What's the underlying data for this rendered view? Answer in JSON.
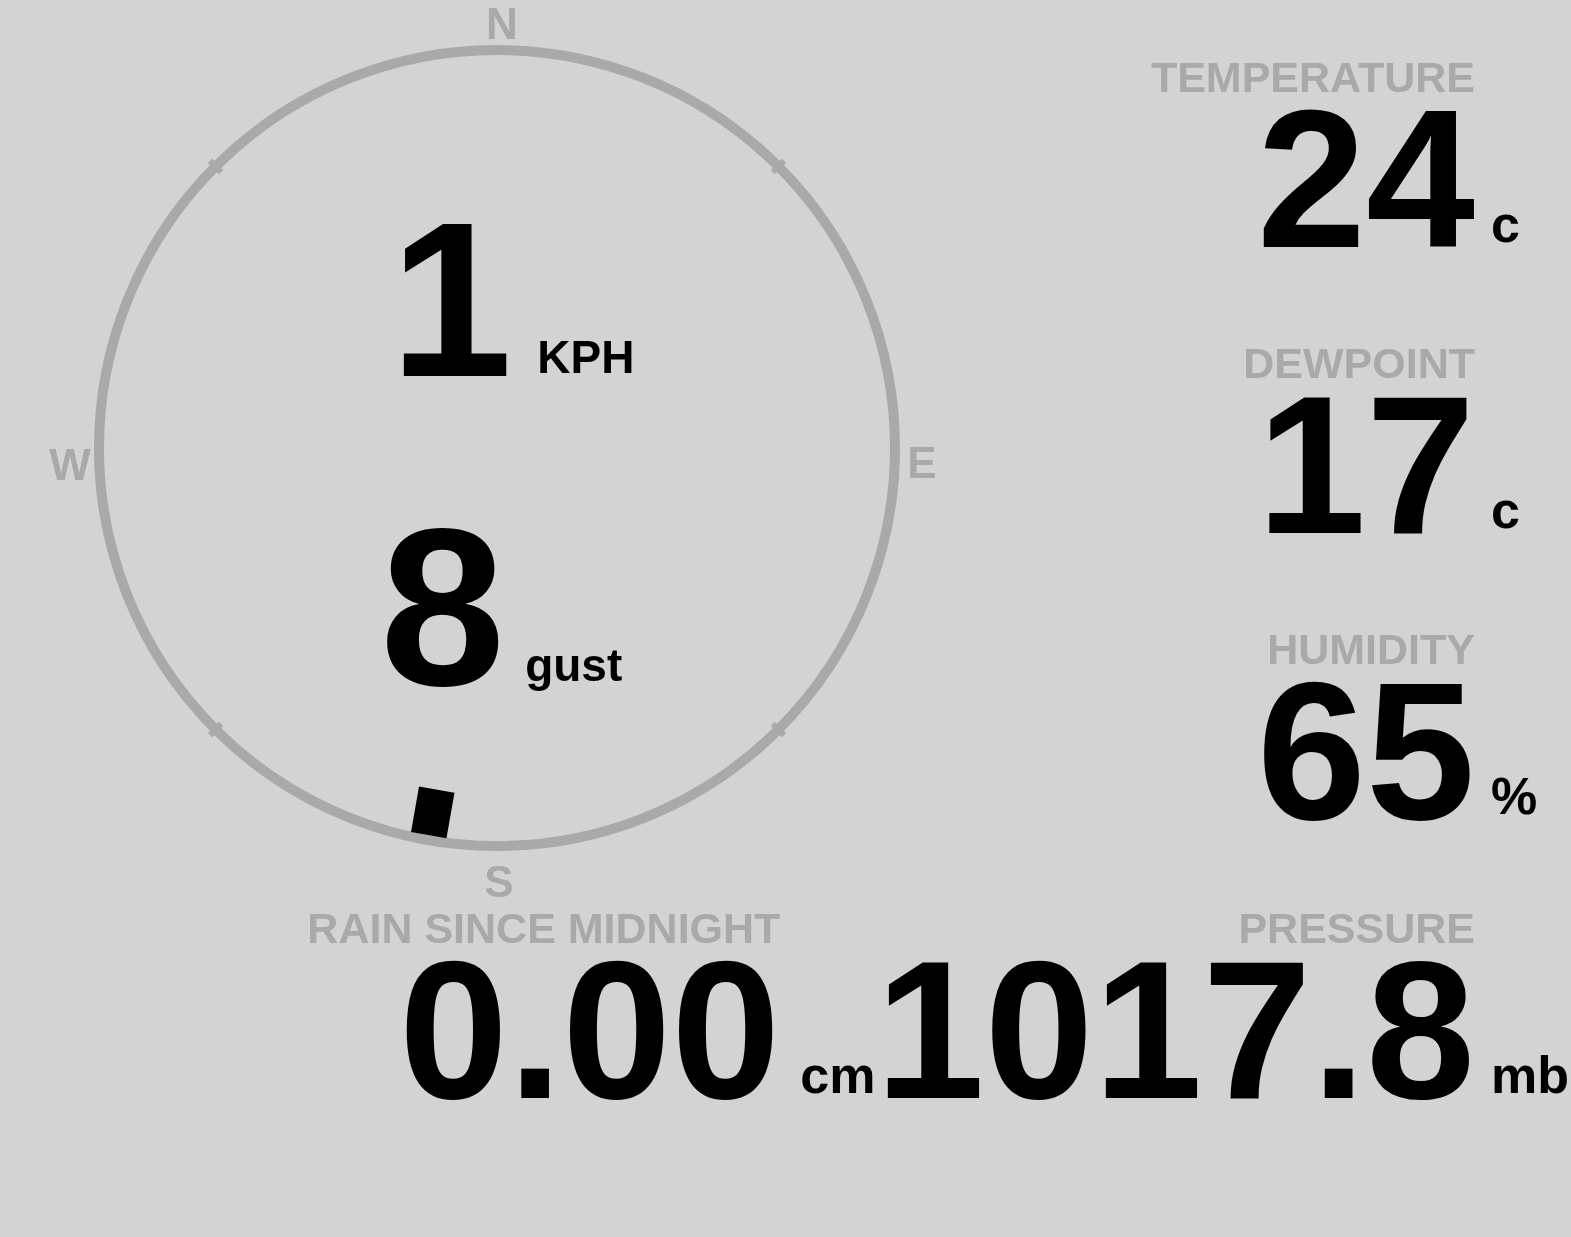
{
  "compass": {
    "north": "N",
    "east": "E",
    "south": "S",
    "west": "W"
  },
  "wind": {
    "speed": "1",
    "speed_unit": "KPH",
    "gust": "8",
    "gust_unit": "gust"
  },
  "stats": [
    {
      "label": "TEMPERATURE",
      "value": "24",
      "unit": "c"
    },
    {
      "label": "DEWPOINT",
      "value": "17",
      "unit": "c"
    },
    {
      "label": "HUMIDITY",
      "value": "65",
      "unit": "%"
    }
  ],
  "rain": {
    "label": "RAIN SINCE MIDNIGHT",
    "value": "0.00",
    "unit": "cm"
  },
  "pressure": {
    "label": "PRESSURE",
    "value": "1017.8",
    "unit": "mb"
  }
}
